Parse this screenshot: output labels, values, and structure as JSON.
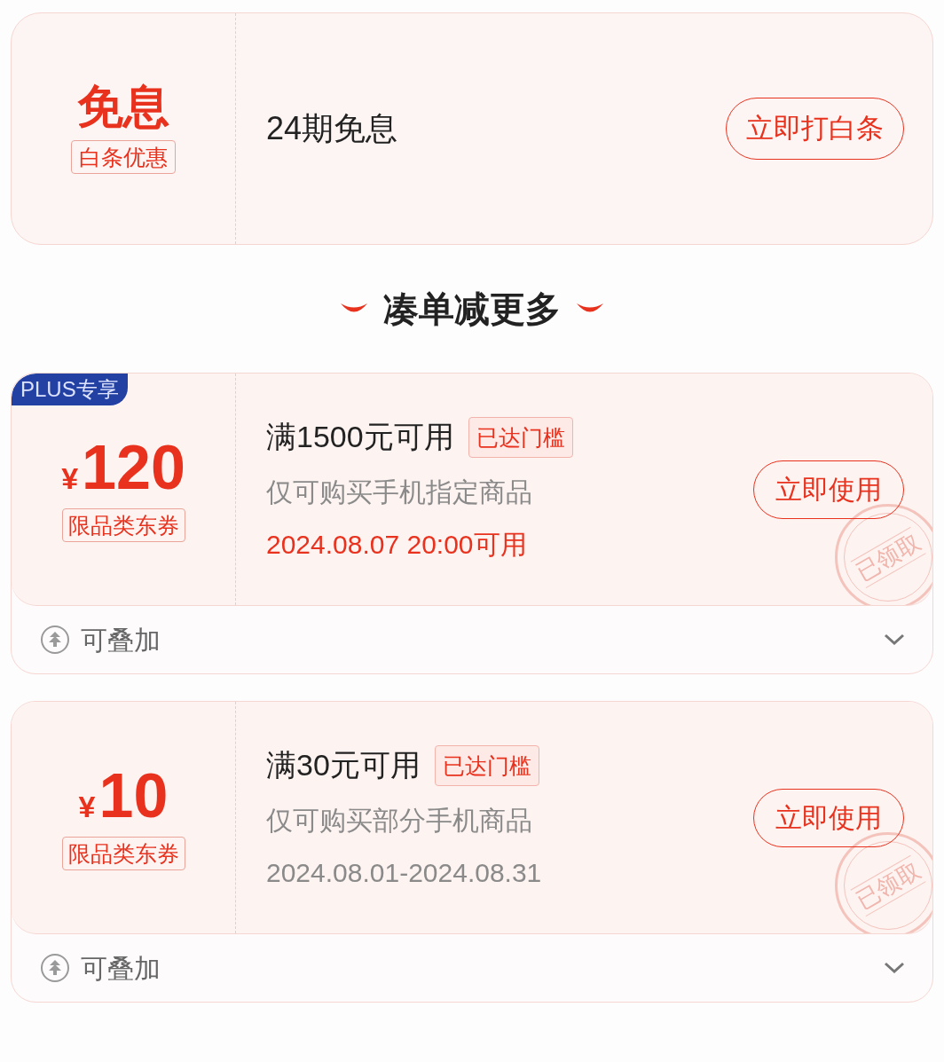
{
  "installment_card": {
    "title": "免息",
    "tag": "白条优惠",
    "description": "24期免息",
    "button": "立即打白条"
  },
  "section_heading": "凑单减更多",
  "coupons": [
    {
      "badge": "PLUS专享",
      "currency": "¥",
      "amount": "120",
      "tag": "限品类东券",
      "condition": "满1500元可用",
      "threshold_tag": "已达门槛",
      "scope": "仅可购买手机指定商品",
      "validity": "2024.08.07 20:00可用",
      "validity_highlight": true,
      "button": "立即使用",
      "stamp": "已领取",
      "stackable": "可叠加",
      "expanded": false
    },
    {
      "currency": "¥",
      "amount": "10",
      "tag": "限品类东券",
      "condition": "满30元可用",
      "threshold_tag": "已达门槛",
      "scope": "仅可购买部分手机商品",
      "validity": "2024.08.01-2024.08.31",
      "validity_highlight": false,
      "button": "立即使用",
      "stamp": "已领取",
      "stackable": "可叠加",
      "expanded": false
    }
  ]
}
